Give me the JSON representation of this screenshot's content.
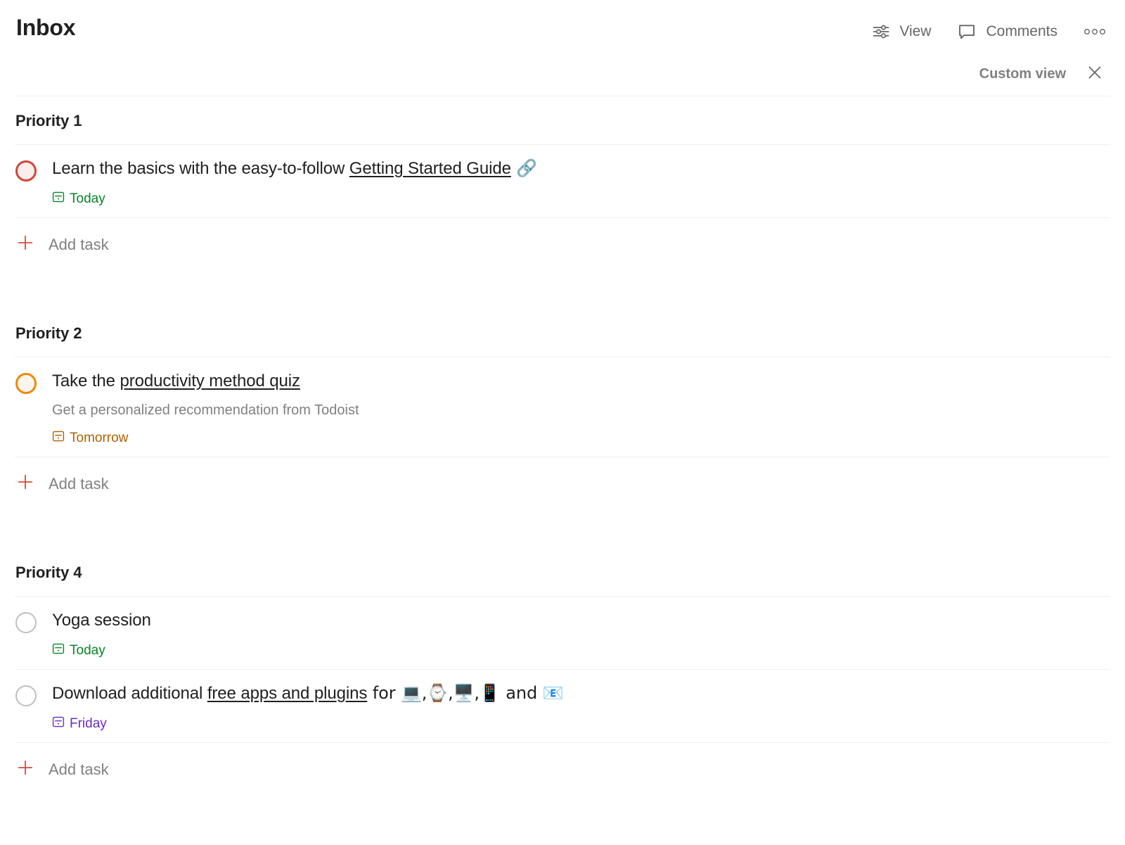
{
  "header": {
    "title": "Inbox",
    "actions": [
      {
        "id": "view",
        "label": "View",
        "icon": "sliders-icon"
      },
      {
        "id": "comments",
        "label": "Comments",
        "icon": "comment-bubble-icon"
      },
      {
        "id": "more",
        "label": "",
        "icon": "more-horizontal-icon"
      }
    ]
  },
  "custom_view": {
    "label": "Custom view",
    "close_icon": "close-icon"
  },
  "add_task_label": "Add task",
  "colors": {
    "priority_1": "#d1453b",
    "priority_2": "#eb8909",
    "priority_4": "#bfbfbf",
    "today": "#058527",
    "tomorrow": "#ad6200",
    "friday": "#692ec2",
    "add_plus": "#dd4b39",
    "text": "#202020",
    "muted": "#808080",
    "divider": "#f0f0f0"
  },
  "sections": [
    {
      "id": "priority-1",
      "title": "Priority 1",
      "tasks": [
        {
          "id": "getting-started-guide",
          "priority": "p1",
          "title_before": "Learn the basics with the easy-to-follow ",
          "title_link": "Getting Started Guide",
          "title_after": " 🔗",
          "description": "",
          "date": "Today",
          "date_color": "green"
        }
      ]
    },
    {
      "id": "priority-2",
      "title": "Priority 2",
      "tasks": [
        {
          "id": "productivity-method-quiz",
          "priority": "p2",
          "title_before": "Take the ",
          "title_link": "productivity method quiz",
          "title_after": "",
          "description": "Get a personalized recommendation from Todoist",
          "date": "Tomorrow",
          "date_color": "orange"
        }
      ]
    },
    {
      "id": "priority-4",
      "title": "Priority 4",
      "tasks": [
        {
          "id": "yoga-session",
          "priority": "p4",
          "title_before": "Yoga session",
          "title_link": "",
          "title_after": "",
          "description": "",
          "date": "Today",
          "date_color": "green"
        },
        {
          "id": "download-free-apps-and-plugins",
          "priority": "p4",
          "title_before": "Download additional ",
          "title_link": "free apps and plugins",
          "title_after": " for 💻,⌚,🖥️,📱 and 📧",
          "description": "",
          "date": "Friday",
          "date_color": "purple"
        }
      ]
    }
  ]
}
